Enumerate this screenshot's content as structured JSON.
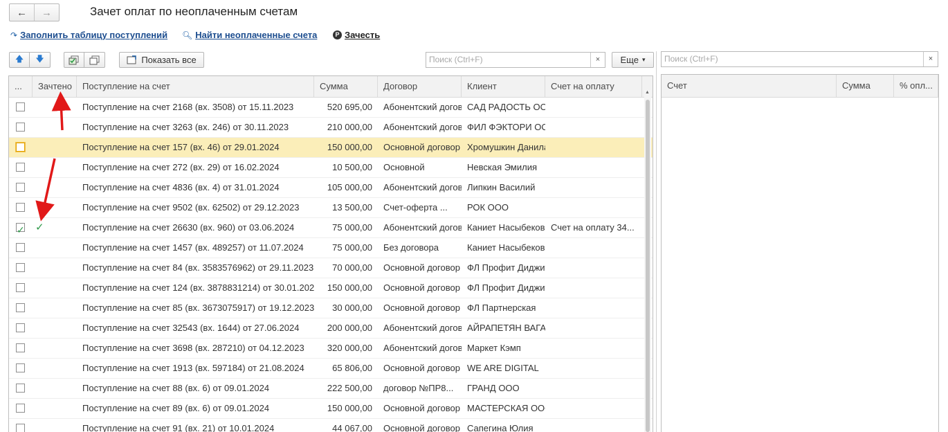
{
  "window": {
    "title": "Зачет оплат по неоплаченным счетам"
  },
  "nav": {
    "back_icon": "←",
    "forward_icon": "→"
  },
  "commands": {
    "fill_table": "Заполнить таблицу поступлений",
    "find_unpaid": "Найти неоплаченные счета",
    "offset": "Зачесть"
  },
  "toolbar": {
    "show_all": "Показать все",
    "search_placeholder": "Поиск (Ctrl+F)",
    "search_clear": "×",
    "more": "Еще",
    "more_arrow": "▾"
  },
  "main_table": {
    "columns": [
      "...",
      "Зачтено",
      "Поступление на счет",
      "Сумма",
      "Договор",
      "Клиент",
      "Счет на оплату"
    ],
    "rows": [
      {
        "checked": false,
        "zachteno": "",
        "receipt": "Поступление на счет 2168 (вх. 3508) от 15.11.2023",
        "sum": "520 695,00",
        "contract": "Абонентский договор",
        "client": "САД РАДОСТЬ ООО",
        "invoice": ""
      },
      {
        "checked": false,
        "zachteno": "",
        "receipt": "Поступление на счет 3263 (вх. 246) от 30.11.2023",
        "sum": "210 000,00",
        "contract": "Абонентский договор",
        "client": "ФИЛ ФЭКТОРИ ООО",
        "invoice": ""
      },
      {
        "checked": false,
        "zachteno": "",
        "receipt": "Поступление на счет 157 (вх. 46) от 29.01.2024",
        "sum": "150 000,00",
        "contract": "Основной договор",
        "client": "Хромушкин Данила",
        "invoice": "",
        "selected": true
      },
      {
        "checked": false,
        "zachteno": "",
        "receipt": "Поступление на счет 272 (вх. 29) от 16.02.2024",
        "sum": "10 500,00",
        "contract": "Основной",
        "client": "Невская Эмилия",
        "invoice": ""
      },
      {
        "checked": false,
        "zachteno": "",
        "receipt": "Поступление на счет 4836 (вх. 4) от 31.01.2024",
        "sum": "105 000,00",
        "contract": "Абонентский договор",
        "client": "Липкин Василий",
        "invoice": ""
      },
      {
        "checked": false,
        "zachteno": "",
        "receipt": "Поступление на счет 9502 (вх. 62502) от 29.12.2023",
        "sum": "13 500,00",
        "contract": "Счет-оферта ...",
        "client": "РОК ООО",
        "invoice": ""
      },
      {
        "checked": true,
        "zachteno": "✓",
        "receipt": "Поступление на счет 26630 (вх. 960) от 03.06.2024",
        "sum": "75 000,00",
        "contract": "Абонентский договор",
        "client": "Каниет Насыбекова",
        "invoice": "Счет на оплату 34..."
      },
      {
        "checked": false,
        "zachteno": "",
        "receipt": "Поступление на счет 1457 (вх. 489257) от 11.07.2024",
        "sum": "75 000,00",
        "contract": "Без договора",
        "client": "Каниет Насыбекова",
        "invoice": ""
      },
      {
        "checked": false,
        "zachteno": "",
        "receipt": "Поступление на счет 84 (вх. 3583576962) от 29.11.2023",
        "sum": "70 000,00",
        "contract": "Основной договор",
        "client": "ФЛ Профит Диджитал",
        "invoice": ""
      },
      {
        "checked": false,
        "zachteno": "",
        "receipt": "Поступление на счет 124 (вх. 3878831214) от 30.01.2024",
        "sum": "150 000,00",
        "contract": "Основной договор",
        "client": "ФЛ Профит Диджитал",
        "invoice": ""
      },
      {
        "checked": false,
        "zachteno": "",
        "receipt": "Поступление на счет 85 (вх. 3673075917) от 19.12.2023",
        "sum": "30 000,00",
        "contract": "Основной договор",
        "client": "ФЛ Партнерская",
        "invoice": ""
      },
      {
        "checked": false,
        "zachteno": "",
        "receipt": "Поступление на счет 32543 (вх. 1644) от 27.06.2024",
        "sum": "200 000,00",
        "contract": "Абонентский договор",
        "client": "АЙРАПЕТЯН ВАГАН",
        "invoice": ""
      },
      {
        "checked": false,
        "zachteno": "",
        "receipt": "Поступление на счет 3698 (вх. 287210) от 04.12.2023",
        "sum": "320 000,00",
        "contract": "Абонентский договор",
        "client": "Маркет Кэмп",
        "invoice": ""
      },
      {
        "checked": false,
        "zachteno": "",
        "receipt": "Поступление на счет 1913 (вх. 597184) от 21.08.2024",
        "sum": "65 806,00",
        "contract": "Основной договор",
        "client": "WE ARE DIGITAL",
        "invoice": ""
      },
      {
        "checked": false,
        "zachteno": "",
        "receipt": "Поступление на счет 88 (вх. 6) от 09.01.2024",
        "sum": "222 500,00",
        "contract": "договор №ПР8...",
        "client": "ГРАНД ООО",
        "invoice": ""
      },
      {
        "checked": false,
        "zachteno": "",
        "receipt": "Поступление на счет 89 (вх. 6) от 09.01.2024",
        "sum": "150 000,00",
        "contract": "Основной договор",
        "client": "МАСТЕРСКАЯ ООО",
        "invoice": ""
      },
      {
        "checked": false,
        "zachteno": "",
        "receipt": "Поступление на счет 91 (вх. 21) от 10.01.2024",
        "sum": "44 067,00",
        "contract": "Основной договор",
        "client": "Сапегина Юлия",
        "invoice": ""
      }
    ]
  },
  "side_panel": {
    "search_placeholder": "Поиск (Ctrl+F)",
    "search_clear": "×",
    "columns": [
      "Счет",
      "Сумма",
      "% опл..."
    ]
  },
  "annotation_color": "#e11919",
  "accent_colors": {
    "link": "#1c4d8f",
    "selected_row": "#fbeeb9",
    "check_green": "#2f9a4a"
  }
}
